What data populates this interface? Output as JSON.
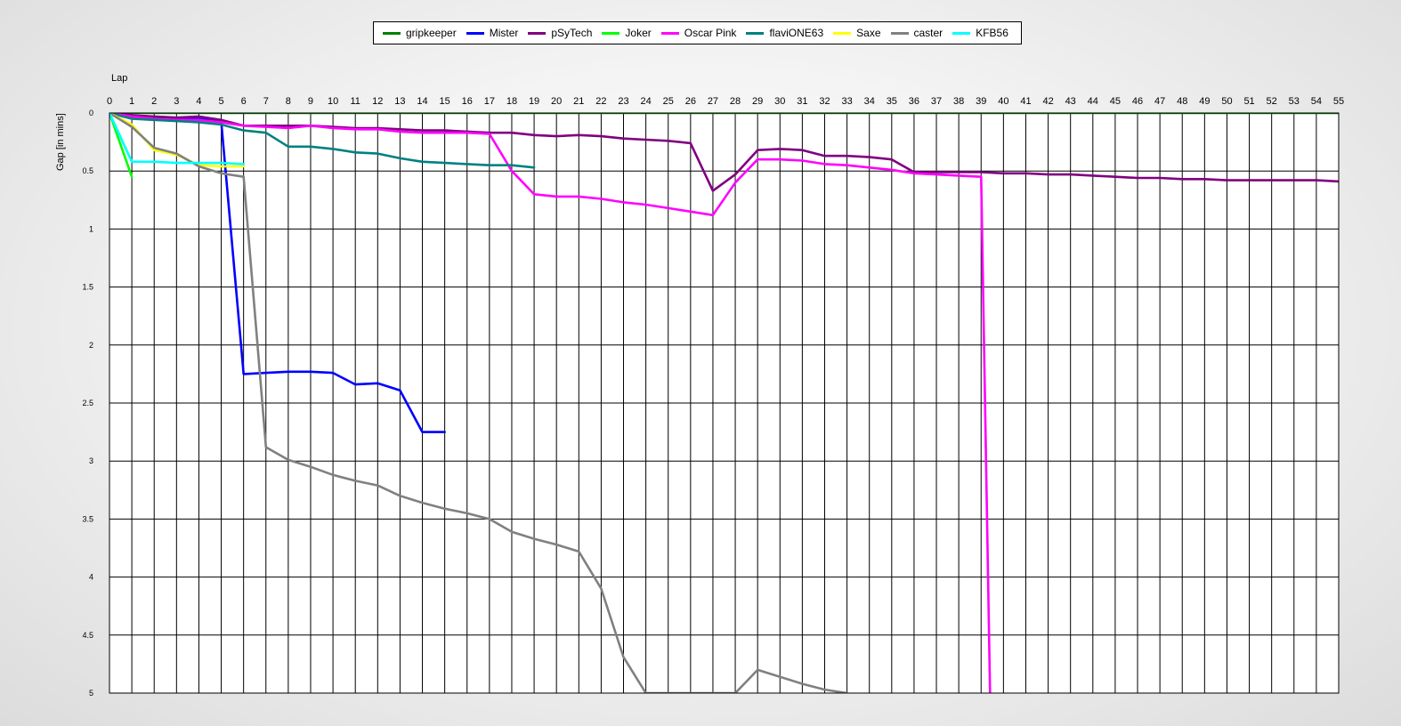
{
  "chart_data": {
    "type": "line",
    "title": "",
    "xlabel": "Lap",
    "ylabel": "Gap [in mins]",
    "x_position": "top",
    "y_inverted": true,
    "xlim": [
      0,
      55
    ],
    "ylim": [
      0,
      5
    ],
    "x_ticks": [
      0,
      1,
      2,
      3,
      4,
      5,
      6,
      7,
      8,
      9,
      10,
      11,
      12,
      13,
      14,
      15,
      16,
      17,
      18,
      19,
      20,
      21,
      22,
      23,
      24,
      25,
      26,
      27,
      28,
      29,
      30,
      31,
      32,
      33,
      34,
      35,
      36,
      37,
      38,
      39,
      40,
      41,
      42,
      43,
      44,
      45,
      46,
      47,
      48,
      49,
      50,
      51,
      52,
      53,
      54,
      55
    ],
    "y_ticks": [
      0,
      0.5,
      1,
      1.5,
      2,
      2.5,
      3,
      3.5,
      4,
      4.5,
      5
    ],
    "y_tick_labels": [
      "0",
      "0.5",
      "1",
      "1.5",
      "2",
      "2.5",
      "3",
      "3.5",
      "4",
      "4.5",
      "5"
    ],
    "grid": true,
    "legend_position": "top-center",
    "series": [
      {
        "name": "gripkeeper",
        "color": "#008000",
        "x": [
          0,
          1,
          2,
          3,
          4,
          5,
          6,
          7,
          8,
          9,
          10,
          11,
          12,
          13,
          14,
          15,
          16,
          17,
          18,
          19,
          20,
          21,
          22,
          23,
          24,
          25,
          26,
          27,
          28,
          29,
          30,
          31,
          32,
          33,
          34,
          35,
          36,
          37,
          38,
          39,
          40,
          41,
          42,
          43,
          44,
          45,
          46,
          47,
          48,
          49,
          50,
          51,
          52,
          53,
          54,
          55
        ],
        "y": [
          0,
          0,
          0,
          0,
          0,
          0,
          0,
          0,
          0,
          0,
          0,
          0,
          0,
          0,
          0,
          0,
          0,
          0,
          0,
          0,
          0,
          0,
          0,
          0,
          0,
          0,
          0,
          0,
          0,
          0,
          0,
          0,
          0,
          0,
          0,
          0,
          0,
          0,
          0,
          0,
          0,
          0,
          0,
          0,
          0,
          0,
          0,
          0,
          0,
          0,
          0,
          0,
          0,
          0,
          0,
          0
        ]
      },
      {
        "name": "Mister",
        "color": "#0000ff",
        "x": [
          0,
          1,
          2,
          3,
          4,
          5,
          6,
          7,
          8,
          9,
          10,
          11,
          12,
          13,
          14,
          15
        ],
        "y": [
          0,
          0.02,
          0.04,
          0.05,
          0.05,
          0.07,
          2.25,
          2.24,
          2.23,
          2.23,
          2.24,
          2.34,
          2.33,
          2.39,
          2.75,
          2.75
        ]
      },
      {
        "name": "pSyTech",
        "color": "#800080",
        "x": [
          0,
          1,
          2,
          3,
          4,
          5,
          6,
          7,
          8,
          9,
          10,
          11,
          12,
          13,
          14,
          15,
          16,
          17,
          18,
          19,
          20,
          21,
          22,
          23,
          24,
          25,
          26,
          27,
          28,
          29,
          30,
          31,
          32,
          33,
          34,
          35,
          36,
          37,
          38,
          39,
          40,
          41,
          42,
          43,
          44,
          45,
          46,
          47,
          48,
          49,
          50,
          51,
          52,
          53,
          54,
          55
        ],
        "y": [
          0,
          0.02,
          0.03,
          0.04,
          0.03,
          0.06,
          0.11,
          0.11,
          0.11,
          0.11,
          0.12,
          0.13,
          0.13,
          0.14,
          0.15,
          0.15,
          0.16,
          0.17,
          0.17,
          0.19,
          0.2,
          0.19,
          0.2,
          0.22,
          0.23,
          0.24,
          0.26,
          0.67,
          0.53,
          0.32,
          0.31,
          0.32,
          0.37,
          0.37,
          0.38,
          0.4,
          0.51,
          0.51,
          0.51,
          0.51,
          0.52,
          0.52,
          0.53,
          0.53,
          0.54,
          0.55,
          0.56,
          0.56,
          0.57,
          0.57,
          0.58,
          0.58,
          0.58,
          0.58,
          0.58,
          0.59
        ]
      },
      {
        "name": "Joker",
        "color": "#00ff00",
        "x": [
          0,
          1
        ],
        "y": [
          0,
          0.55
        ]
      },
      {
        "name": "Oscar Pink",
        "color": "#ff00ff",
        "x": [
          0,
          1,
          2,
          3,
          4,
          5,
          6,
          7,
          8,
          9,
          10,
          11,
          12,
          13,
          14,
          15,
          16,
          17,
          18,
          19,
          20,
          21,
          22,
          23,
          24,
          25,
          26,
          27,
          28,
          29,
          30,
          31,
          32,
          33,
          34,
          35,
          36,
          37,
          38,
          39,
          39.4
        ],
        "y": [
          0,
          0.03,
          0.05,
          0.06,
          0.06,
          0.08,
          0.11,
          0.12,
          0.13,
          0.11,
          0.13,
          0.14,
          0.14,
          0.16,
          0.17,
          0.17,
          0.17,
          0.18,
          0.5,
          0.7,
          0.72,
          0.72,
          0.74,
          0.77,
          0.79,
          0.82,
          0.85,
          0.88,
          0.6,
          0.4,
          0.4,
          0.41,
          0.44,
          0.45,
          0.47,
          0.49,
          0.52,
          0.53,
          0.54,
          0.55,
          5.0
        ]
      },
      {
        "name": "flaviONE63",
        "color": "#008080",
        "x": [
          0,
          1,
          2,
          3,
          4,
          5,
          6,
          7,
          8,
          9,
          10,
          11,
          12,
          13,
          14,
          15,
          16,
          17,
          18,
          19
        ],
        "y": [
          0,
          0.05,
          0.06,
          0.07,
          0.08,
          0.1,
          0.15,
          0.17,
          0.29,
          0.29,
          0.31,
          0.34,
          0.35,
          0.39,
          0.42,
          0.43,
          0.44,
          0.45,
          0.45,
          0.47
        ]
      },
      {
        "name": "Saxe",
        "color": "#ffff00",
        "x": [
          0,
          1,
          2,
          3,
          4,
          5,
          6
        ],
        "y": [
          0,
          0.1,
          0.32,
          0.36,
          0.45,
          0.46,
          0.46
        ]
      },
      {
        "name": "caster",
        "color": "#808080",
        "x": [
          0,
          1,
          2,
          3,
          4,
          5,
          6,
          7,
          8,
          9,
          10,
          11,
          12,
          13,
          14,
          15,
          16,
          17,
          18,
          19,
          20,
          21,
          22,
          23,
          24,
          28,
          29,
          30,
          31,
          32,
          33
        ],
        "y": [
          0,
          0.12,
          0.3,
          0.35,
          0.46,
          0.52,
          0.55,
          2.88,
          2.99,
          3.05,
          3.12,
          3.17,
          3.21,
          3.3,
          3.36,
          3.41,
          3.45,
          3.5,
          3.61,
          3.67,
          3.72,
          3.78,
          4.1,
          4.69,
          5.0,
          5.0,
          4.8,
          4.86,
          4.92,
          4.97,
          5.0
        ]
      },
      {
        "name": "KFB56",
        "color": "#00ffff",
        "x": [
          0,
          1,
          2,
          3,
          4,
          5,
          6
        ],
        "y": [
          0,
          0.42,
          0.42,
          0.43,
          0.43,
          0.43,
          0.44
        ]
      }
    ]
  }
}
